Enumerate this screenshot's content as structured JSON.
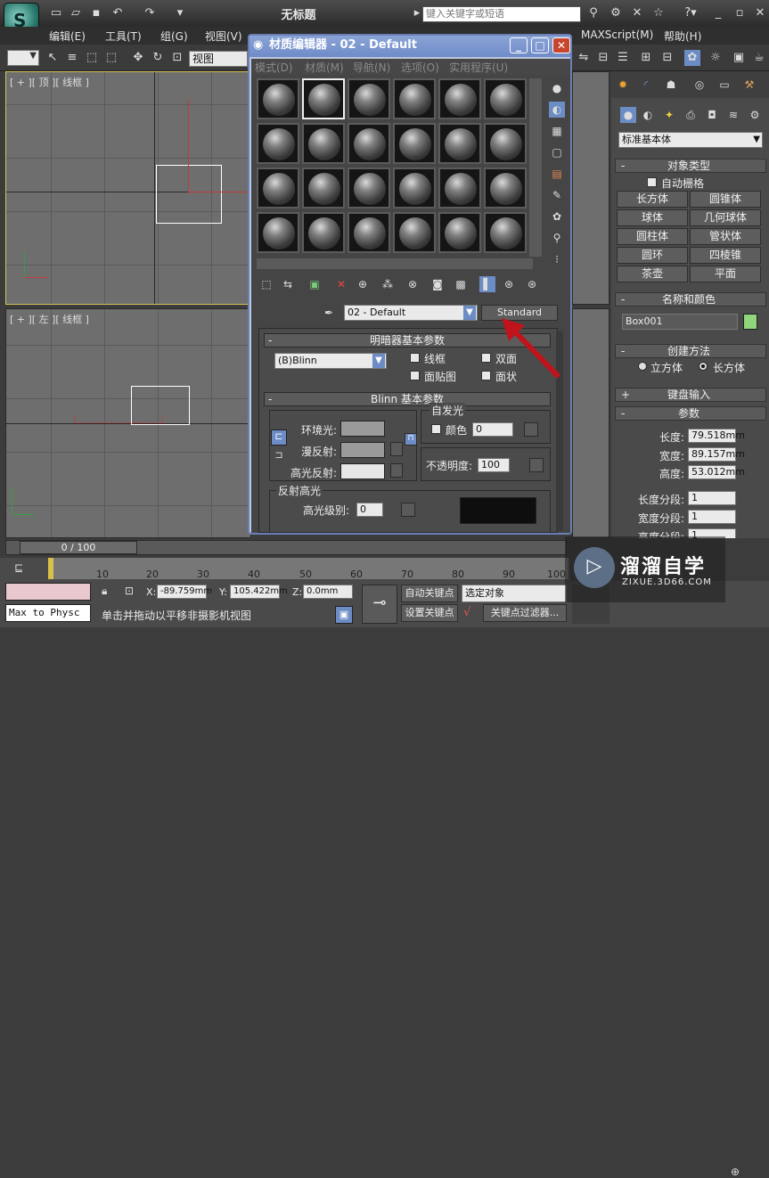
{
  "app": {
    "title": "无标题",
    "logo_glyph": "S",
    "search_placeholder": "键入关键字或短语"
  },
  "menubar": {
    "items": [
      "编辑(E)",
      "工具(T)",
      "组(G)",
      "视图(V)"
    ],
    "maxscript": "MAXScript(M)",
    "help": "帮助(H)"
  },
  "toolbar": {
    "view_select": "视图"
  },
  "viewports": {
    "top_label": "[ + ][ 顶 ][ 线框 ]",
    "left_label": "[ + ][ 左 ][ 线框 ]"
  },
  "material_editor": {
    "title": "材质编辑器 - 02 - Default",
    "menu": [
      "模式(D)",
      "材质(M)",
      "导航(N)",
      "选项(O)",
      "实用程序(U)"
    ],
    "material_name": "02 - Default",
    "material_type": "Standard",
    "shader_rollout": "明暗器基本参数",
    "shader": "(B)Blinn",
    "checkbox_wire": "线框",
    "checkbox_2sided": "双面",
    "checkbox_facemap": "面贴图",
    "checkbox_faceted": "面状",
    "blinn_rollout": "Blinn 基本参数",
    "self_illum": "自发光",
    "color_label": "颜色",
    "color_value": "0",
    "ambient": "环境光:",
    "diffuse": "漫反射:",
    "specular": "高光反射:",
    "opacity_label": "不透明度:",
    "opacity_value": "100",
    "spec_highlights": "反射高光",
    "spec_level_label": "高光级别:",
    "spec_level_value": "0",
    "colors": {
      "ambient": "#9a9a9a",
      "diffuse": "#9a9a9a",
      "specular": "#e6e6e6",
      "preview": "#0e0e0e"
    }
  },
  "command_panel": {
    "dropdown": "标准基本体",
    "object_type": "对象类型",
    "autogrid": "自动栅格",
    "buttons": [
      "长方体",
      "圆锥体",
      "球体",
      "几何球体",
      "圆柱体",
      "管状体",
      "圆环",
      "四棱锥",
      "茶壶",
      "平面"
    ],
    "name_color": "名称和颜色",
    "object_name": "Box001",
    "object_color": "#90d67a",
    "creation_method": "创建方法",
    "radio_cube": "立方体",
    "radio_box": "长方体",
    "keyboard_entry": "键盘输入",
    "parameters": "参数",
    "length_label": "长度:",
    "length": "79.518mm",
    "width_label": "宽度:",
    "width": "89.157mm",
    "height_label": "高度:",
    "height": "53.012mm",
    "len_segs_label": "长度分段:",
    "len_segs": "1",
    "wid_segs_label": "宽度分段:",
    "wid_segs": "1",
    "hei_segs_label": "高度分段:",
    "hei_segs": "1"
  },
  "timeline": {
    "frame": "0 / 100",
    "ticks": [
      "10",
      "20",
      "30",
      "40",
      "50",
      "60",
      "70",
      "80",
      "90",
      "100"
    ]
  },
  "status": {
    "script_listener": "Max to Physc",
    "x_label": "X:",
    "x": "-89.759mm",
    "y_label": "Y:",
    "y": "105.422mm",
    "z_label": "Z:",
    "z": "0.0mm",
    "auto_key": "自动关键点",
    "set_key": "设置关键点",
    "selected": "选定对象",
    "key_filters": "关键点过滤器...",
    "prompt": "单击并拖动以平移非摄影机视图"
  },
  "watermark": {
    "brand": "溜溜自学",
    "url": "ZIXUE.3D66.COM"
  }
}
